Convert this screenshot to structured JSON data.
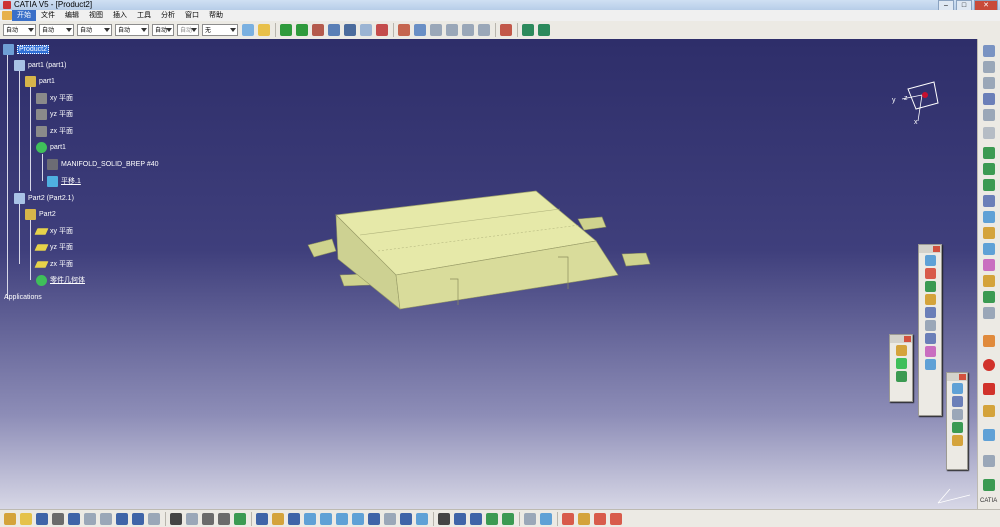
{
  "window": {
    "title": "CATIA V5 - [Product2]"
  },
  "menu": [
    "开始",
    "文件",
    "编辑",
    "视图",
    "插入",
    "工具",
    "分析",
    "窗口",
    "帮助"
  ],
  "toolbar": {
    "combos": [
      "自动",
      "自动",
      "自动",
      "自动",
      "自动",
      "自动",
      "无"
    ]
  },
  "tree": {
    "root": "Product2",
    "part1_instance": "part1 (part1)",
    "part1": "part1",
    "xy": "xy 平面",
    "yz": "yz 平面",
    "zx": "zx 平面",
    "body1": "part1",
    "brep": "MANIFOLD_SOLID_BREP #40",
    "plane1": "平移.1",
    "part2_instance": "Part2 (Part2.1)",
    "part2": "Part2",
    "xy2": "xy 平面",
    "yz2": "yz 平面",
    "zx2": "zx 平面",
    "geoset": "零件几何体",
    "apps": "Applications"
  },
  "compass": {
    "y": "y",
    "z": "z",
    "x": "x"
  },
  "logo": "CATIA",
  "colors": {
    "model": "#e2e6a2",
    "background_top": "#2e2e6a",
    "background_bottom": "#d7d7e6",
    "selection": "#2f6fd6"
  }
}
